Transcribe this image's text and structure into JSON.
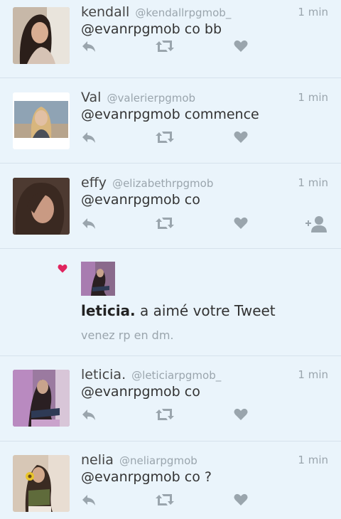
{
  "tweets_top": [
    {
      "name": "kendall",
      "handle": "@kendallrpgmob_",
      "time": "1 min",
      "text": "@evanrpgmob co bb"
    },
    {
      "name": "Val",
      "handle": "@valerierpgmob",
      "time": "1 min",
      "text": "@evanrpgmob commence"
    },
    {
      "name": "effy",
      "handle": "@elizabethrpgmob",
      "time": "1 min",
      "text": "@evanrpgmob co"
    }
  ],
  "notification": {
    "user": "leticia.",
    "action": " a aimé votre Tweet",
    "snippet": "venez rp en dm."
  },
  "tweets_bottom": [
    {
      "name": "leticia.",
      "handle": "@leticiarpgmob_",
      "time": "1 min",
      "text": "@evanrpgmob co"
    },
    {
      "name": "nelia",
      "handle": "@neliarpgmob",
      "time": "1 min",
      "text": "@evanrpgmob co ?"
    }
  ],
  "colors": {
    "background": "#eaf4fb",
    "icon": "#9aa5ad",
    "like_heart": "#e0245e"
  },
  "icons": [
    "reply-icon",
    "retweet-icon",
    "like-icon",
    "follow-icon"
  ]
}
